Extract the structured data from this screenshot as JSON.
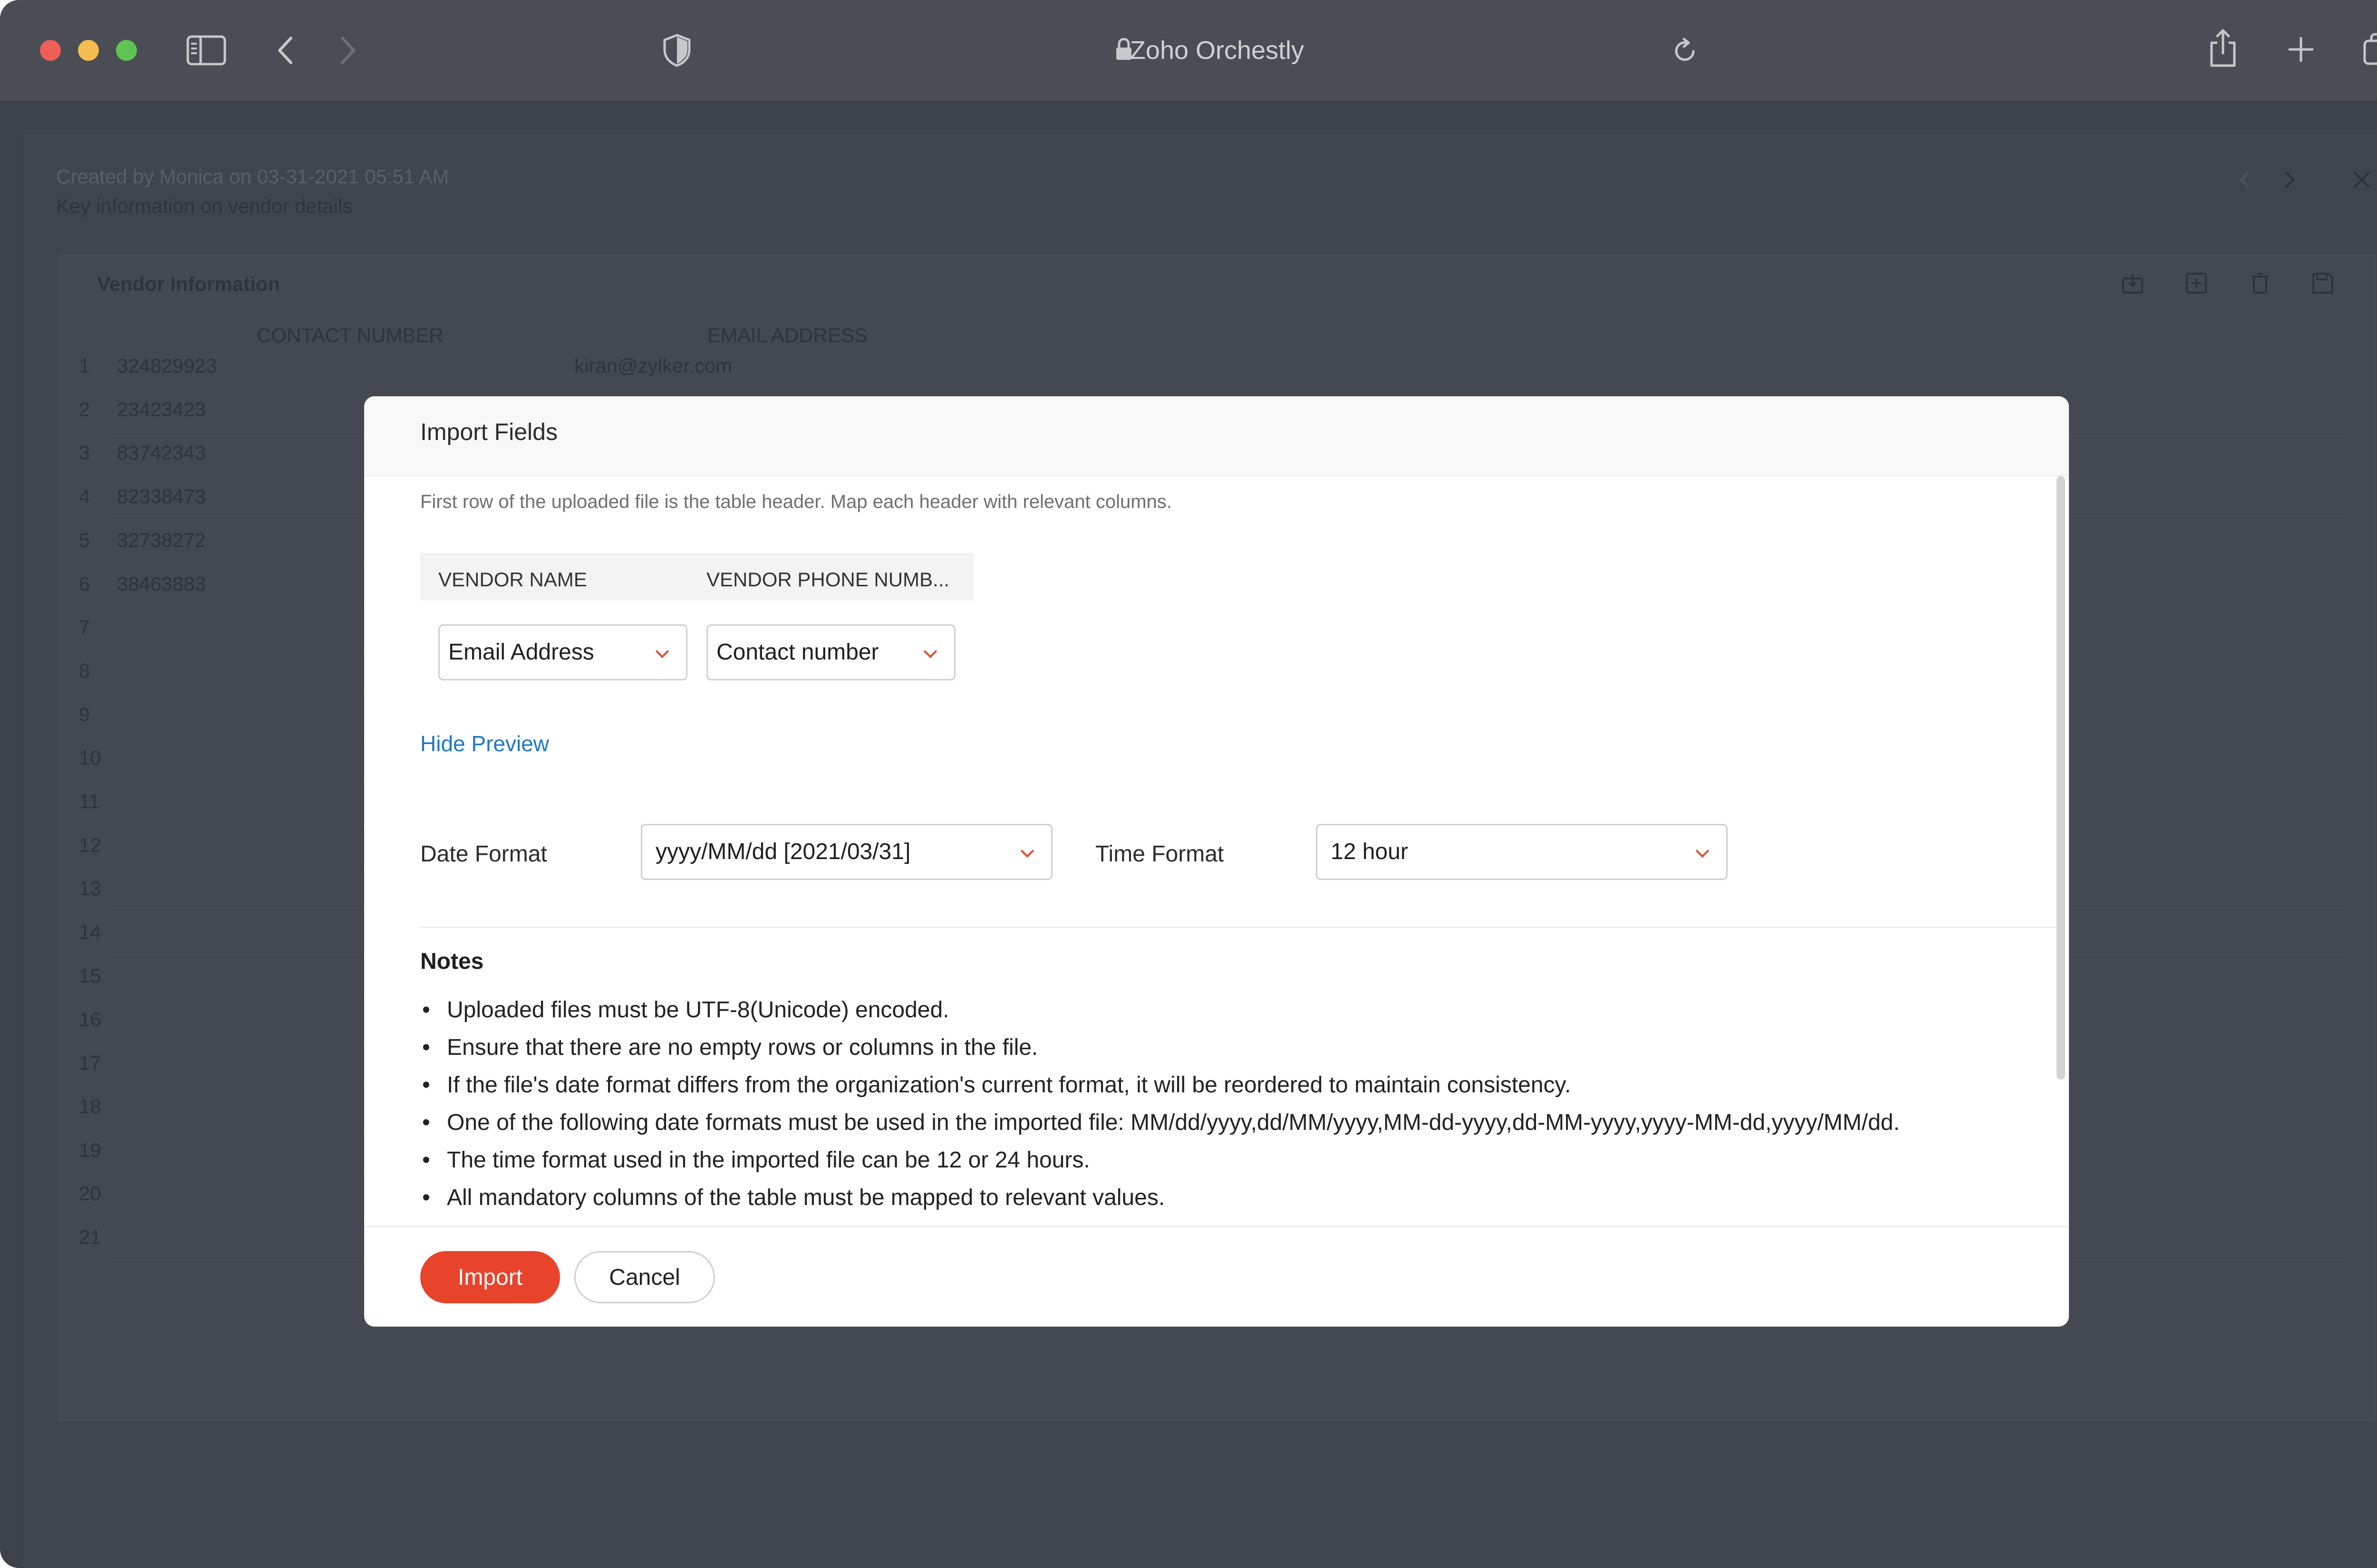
{
  "browser": {
    "url_label": "Zoho Orchestly",
    "colors": {
      "close": "#ee5f57",
      "minimize": "#f5bd4f",
      "zoom": "#5fc454"
    }
  },
  "background": {
    "created_by": "Created by Monica on 03-31-2021 05:51 AM",
    "description": "Key information on vendor details",
    "card_title": "Vendor Information",
    "columns": [
      "CONTACT NUMBER",
      "EMAIL ADDRESS"
    ],
    "rows": [
      {
        "num": "1",
        "contact": "324829923",
        "email": "kiran@zylker.com"
      },
      {
        "num": "2",
        "contact": "23423423",
        "email": ""
      },
      {
        "num": "3",
        "contact": "83742343",
        "email": ""
      },
      {
        "num": "4",
        "contact": "82338473",
        "email": ""
      },
      {
        "num": "5",
        "contact": "32738272",
        "email": ""
      },
      {
        "num": "6",
        "contact": "38463883",
        "email": ""
      },
      {
        "num": "7",
        "contact": "",
        "email": ""
      },
      {
        "num": "8",
        "contact": "",
        "email": ""
      },
      {
        "num": "9",
        "contact": "",
        "email": ""
      },
      {
        "num": "10",
        "contact": "",
        "email": ""
      },
      {
        "num": "11",
        "contact": "",
        "email": ""
      },
      {
        "num": "12",
        "contact": "",
        "email": ""
      },
      {
        "num": "13",
        "contact": "",
        "email": ""
      },
      {
        "num": "14",
        "contact": "",
        "email": ""
      },
      {
        "num": "15",
        "contact": "",
        "email": ""
      },
      {
        "num": "16",
        "contact": "",
        "email": ""
      },
      {
        "num": "17",
        "contact": "",
        "email": ""
      },
      {
        "num": "18",
        "contact": "",
        "email": ""
      },
      {
        "num": "19",
        "contact": "",
        "email": ""
      },
      {
        "num": "20",
        "contact": "",
        "email": ""
      },
      {
        "num": "21",
        "contact": "",
        "email": ""
      }
    ]
  },
  "modal": {
    "title": "Import Fields",
    "description": "First row of the uploaded file is the table header. Map each header with relevant columns.",
    "mapping": {
      "headers": [
        "VENDOR NAME",
        "VENDOR PHONE NUMB..."
      ],
      "selects": [
        "Email Address",
        "Contact number"
      ]
    },
    "hide_preview": "Hide Preview",
    "date_format": {
      "label": "Date Format",
      "value": "yyyy/MM/dd   [2021/03/31]"
    },
    "time_format": {
      "label": "Time Format",
      "value": "12 hour"
    },
    "notes_title": "Notes",
    "notes": [
      "Uploaded files must be UTF-8(Unicode) encoded.",
      "Ensure that there are no empty rows or columns in the file.",
      "If the file's date format differs from the organization's current format, it will be reordered to maintain consistency.",
      "One of the following date formats must be used in the imported file: MM/dd/yyyy,dd/MM/yyyy,MM-dd-yyyy,dd-MM-yyyy,yyyy-MM-dd,yyyy/MM/dd.",
      "The time format used in the imported file can be 12 or 24 hours.",
      "All mandatory columns of the table must be mapped to relevant values."
    ],
    "buttons": {
      "import": "Import",
      "cancel": "Cancel"
    },
    "accent_color": "#e8432b",
    "link_color": "#1f77c4"
  }
}
